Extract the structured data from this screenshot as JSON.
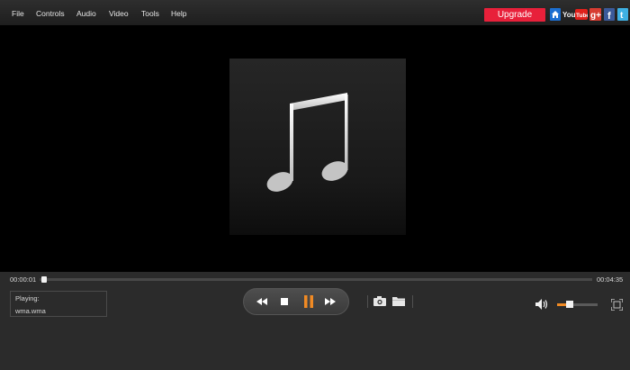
{
  "menu": [
    {
      "id": "file",
      "label": "File"
    },
    {
      "id": "controls",
      "label": "Controls"
    },
    {
      "id": "audio",
      "label": "Audio"
    },
    {
      "id": "video",
      "label": "Video"
    },
    {
      "id": "tools",
      "label": "Tools"
    },
    {
      "id": "help",
      "label": "Help"
    }
  ],
  "header": {
    "upgrade_label": "Upgrade",
    "social_icons": [
      "home-icon",
      "youtube-icon",
      "google-plus-icon",
      "facebook-icon",
      "twitter-icon"
    ],
    "youtube_text": "You Tube",
    "gplus_text": "g+",
    "facebook_text": "f",
    "twitter_text": "t"
  },
  "media": {
    "artwork_icon": "music-note-icon"
  },
  "player": {
    "current_time": "00:00:01",
    "total_time": "00:04:35",
    "progress_fraction": 0.004,
    "playing_label": "Playing:",
    "file_name": "wma.wma",
    "volume_fraction": 0.3,
    "state": "playing"
  },
  "colors": {
    "accent": "#f08a24",
    "upgrade": "#e8203a",
    "background": "#000000",
    "panel": "#2b2b2b"
  }
}
